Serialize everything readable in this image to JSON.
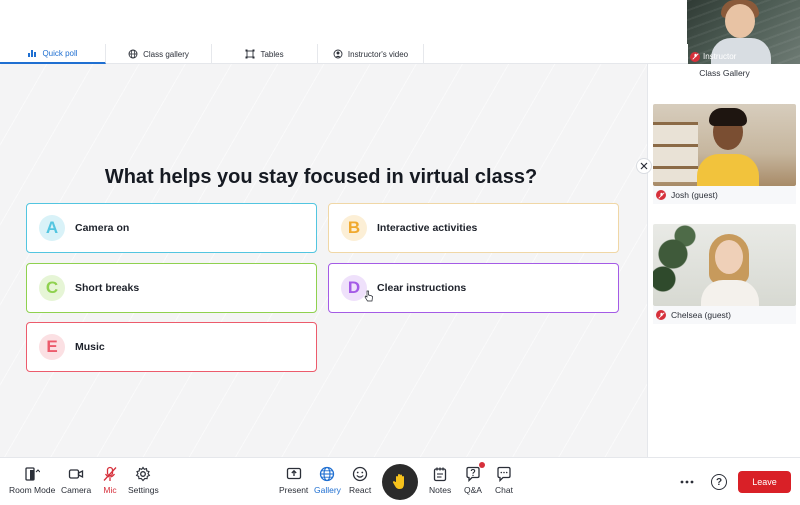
{
  "instructor": {
    "label": "Instructor"
  },
  "tabs": [
    {
      "label": "Quick poll",
      "icon": "bar-chart-icon",
      "active": true
    },
    {
      "label": "Class gallery",
      "icon": "globe-icon",
      "active": false
    },
    {
      "label": "Tables",
      "icon": "tables-icon",
      "active": false
    },
    {
      "label": "Instructor's video",
      "icon": "video-icon",
      "active": false
    }
  ],
  "poll": {
    "question": "What helps you stay focused in virtual class?",
    "options": [
      {
        "letter": "A",
        "label": "Camera on",
        "color": "#52c5e0",
        "tint": "#d9f2f8"
      },
      {
        "letter": "B",
        "label": "Interactive activities",
        "color": "#f0a92e",
        "tint": "#fcefd6"
      },
      {
        "letter": "C",
        "label": "Short breaks",
        "color": "#8fd14f",
        "tint": "#e6f5d6"
      },
      {
        "letter": "D",
        "label": "Clear instructions",
        "color": "#a45be6",
        "tint": "#efe1fb"
      },
      {
        "letter": "E",
        "label": "Music",
        "color": "#ec5b6c",
        "tint": "#fbe0e3"
      }
    ]
  },
  "gallery": {
    "title": "Class Gallery",
    "participants": [
      {
        "name": "Josh (guest)"
      },
      {
        "name": "Chelsea (guest)"
      }
    ]
  },
  "toolbar": {
    "room_mode": "Room Mode",
    "camera": "Camera",
    "mic": "Mic",
    "settings": "Settings",
    "present": "Present",
    "gallery": "Gallery",
    "react": "React",
    "notes": "Notes",
    "qa": "Q&A",
    "chat": "Chat",
    "help": "?",
    "leave": "Leave"
  },
  "colors": {
    "accent": "#1f6fd1",
    "danger": "#d92027"
  }
}
